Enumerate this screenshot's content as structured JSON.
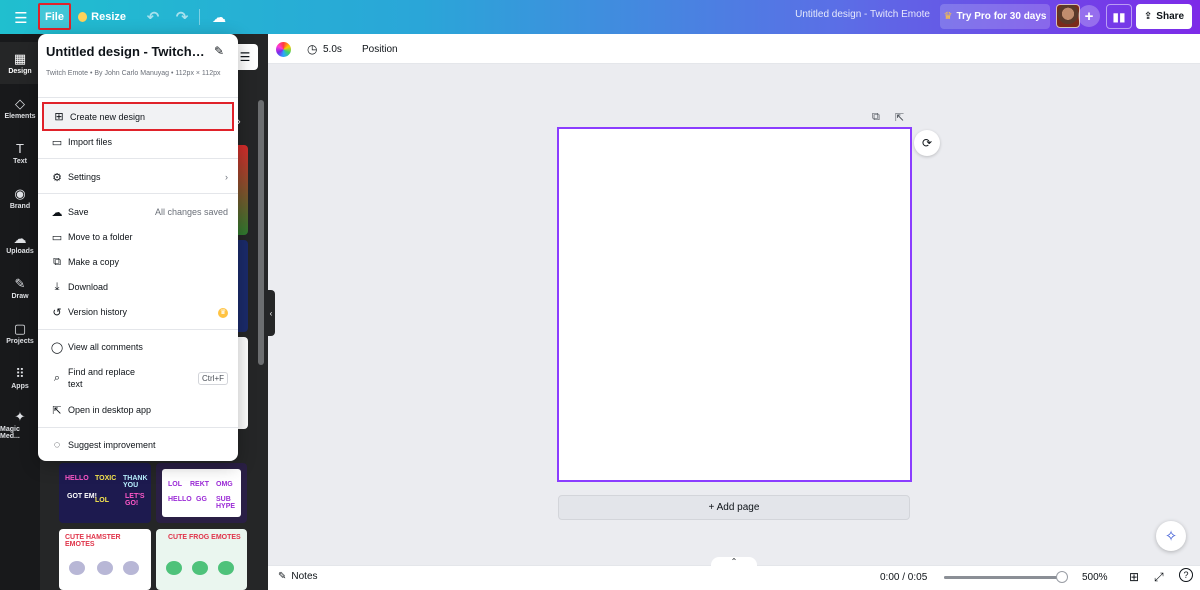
{
  "topbar": {
    "file_label": "File",
    "resize_label": "Resize",
    "doc_title": "Untitled design - Twitch Emote",
    "try_pro_label": "Try Pro for 30 days",
    "share_label": "Share"
  },
  "rail": {
    "items": [
      {
        "label": "Design",
        "icon": "design-icon"
      },
      {
        "label": "Elements",
        "icon": "elements-icon"
      },
      {
        "label": "Text",
        "icon": "text-icon"
      },
      {
        "label": "Brand",
        "icon": "brand-icon"
      },
      {
        "label": "Uploads",
        "icon": "uploads-icon"
      },
      {
        "label": "Draw",
        "icon": "draw-icon"
      },
      {
        "label": "Projects",
        "icon": "projects-icon"
      },
      {
        "label": "Apps",
        "icon": "apps-icon"
      },
      {
        "label": "Magic Med...",
        "icon": "magic-media-icon"
      }
    ]
  },
  "toolbar": {
    "duration": "5.0s",
    "position_label": "Position"
  },
  "menu": {
    "title": "Untitled design - Twitch Emote",
    "subtitle": "Twitch Emote • By John Carlo Manuyag • 112px × 112px",
    "items": {
      "create_new": "Create new design",
      "import_files": "Import files",
      "settings": "Settings",
      "save": "Save",
      "save_status": "All changes saved",
      "move_folder": "Move to a folder",
      "make_copy": "Make a copy",
      "download": "Download",
      "version_history": "Version history",
      "view_comments": "View all comments",
      "find_replace": "Find and replace text",
      "find_shortcut": "Ctrl+F",
      "open_desktop": "Open in desktop app",
      "suggest": "Suggest improvement"
    }
  },
  "templates": {
    "t1_words": [
      "HELLO",
      "TOXIC",
      "THANK YOU",
      "GOT EM!",
      "LOL",
      "LET'S GO!"
    ],
    "t2_words": [
      "LOL",
      "REKT",
      "OMG",
      "HELLO",
      "GG",
      "SUB HYPE"
    ],
    "t3_title": "CUTE HAMSTER EMOTES",
    "t4_title": "CUTE FROG EMOTES"
  },
  "canvas": {
    "add_page_label": "+ Add page"
  },
  "bottombar": {
    "notes_label": "Notes",
    "time": "0:00 / 0:05",
    "zoom": "500%",
    "playback_progress": 0.97
  },
  "colors": {
    "accent": "#8b3dff",
    "highlight": "#e0222a",
    "dark_rail": "#18191b"
  }
}
